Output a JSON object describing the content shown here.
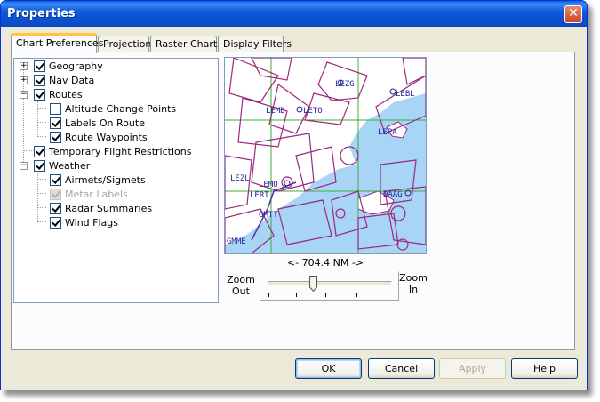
{
  "window": {
    "title": "Properties"
  },
  "tabs": [
    {
      "label": "Chart Preferences",
      "active": true
    },
    {
      "label": "Projection",
      "active": false
    },
    {
      "label": "Raster Charts",
      "active": false
    },
    {
      "label": "Display Filters",
      "active": false
    }
  ],
  "tree": [
    {
      "label": "Geography",
      "checked": true,
      "expander": "+",
      "level": 0
    },
    {
      "label": "Nav Data",
      "checked": true,
      "expander": "+",
      "level": 0
    },
    {
      "label": "Routes",
      "checked": true,
      "expander": "−",
      "level": 0
    },
    {
      "label": "Altitude Change Points",
      "checked": false,
      "level": 1
    },
    {
      "label": "Labels On Route",
      "checked": true,
      "level": 1
    },
    {
      "label": "Route Waypoints",
      "checked": true,
      "level": 1
    },
    {
      "label": "Temporary Flight Restrictions",
      "checked": true,
      "level": 0
    },
    {
      "label": "Weather",
      "checked": true,
      "expander": "−",
      "level": 0
    },
    {
      "label": "Airmets/Sigmets",
      "checked": true,
      "level": 1
    },
    {
      "label": "Metar Labels",
      "checked": true,
      "disabled": true,
      "level": 1
    },
    {
      "label": "Radar Summaries",
      "checked": true,
      "level": 1
    },
    {
      "label": "Wind Flags",
      "checked": true,
      "level": 1
    }
  ],
  "map": {
    "labels": [
      "LEZG",
      "LEBL",
      "LEMD",
      "LETO",
      "LEPA",
      "LEZL",
      "LEMO",
      "LERT",
      "GMTT",
      "DAAG",
      "GMME"
    ],
    "distance": "<- 704.4 NM ->"
  },
  "zoom": {
    "out_label": "Zoom\nOut",
    "in_label": "Zoom\nIn",
    "level": 0.37
  },
  "buttons": {
    "ok": "OK",
    "cancel": "Cancel",
    "apply": "Apply",
    "help": "Help"
  },
  "colors": {
    "titlebar": "#0B4FCF",
    "water": "#A8D4F5",
    "airspace": "#9B2A7C",
    "grid": "#3DAE3D"
  }
}
